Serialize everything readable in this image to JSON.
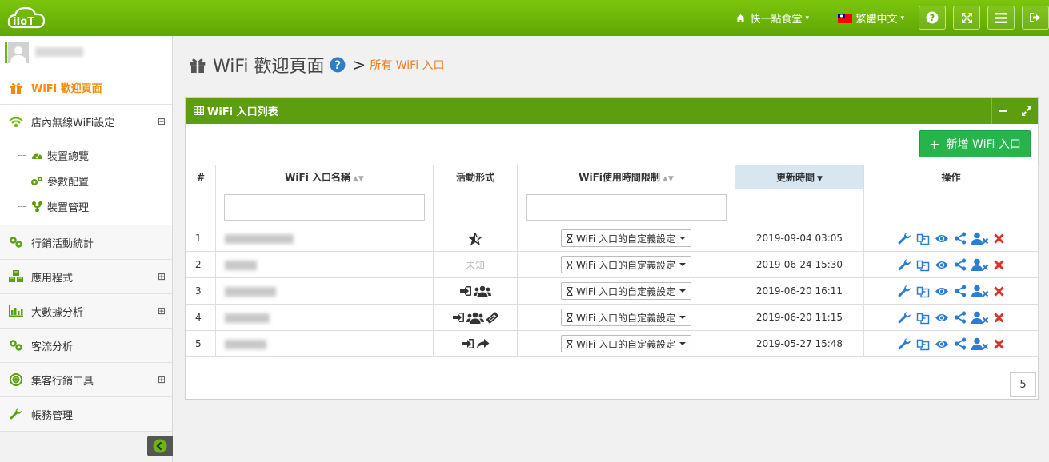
{
  "navbar": {
    "logo_text": "iIoT",
    "store": "快一點食堂",
    "language": "繁體中文",
    "flag_colors": {
      "red": "#fe0000",
      "blue": "#000095"
    }
  },
  "sidebar": {
    "items": [
      {
        "label": "WiFi 歡迎頁面",
        "icon": "gift-icon",
        "active": true
      },
      {
        "label": "店內無線WiFi設定",
        "icon": "wifi-icon",
        "expanded": true
      },
      {
        "label": "行銷活動統計",
        "icon": "link-icon"
      },
      {
        "label": "應用程式",
        "icon": "cubes-icon",
        "expandable": true
      },
      {
        "label": "大數據分析",
        "icon": "bar-chart-icon",
        "expandable": true
      },
      {
        "label": "客流分析",
        "icon": "link-icon"
      },
      {
        "label": "集客行銷工具",
        "icon": "target-icon",
        "expandable": true
      },
      {
        "label": "帳務管理",
        "icon": "wrench-icon"
      }
    ],
    "sub_items": [
      {
        "label": "裝置總覽",
        "icon": "dashboard-icon"
      },
      {
        "label": "參數配置",
        "icon": "cogs-icon"
      },
      {
        "label": "裝置管理",
        "icon": "sitemap-icon"
      }
    ],
    "expanded_symbol": "⊟",
    "collapsed_symbol": "⊞"
  },
  "page": {
    "title": "WiFi 歡迎頁面",
    "breadcrumb_sep": ">",
    "breadcrumb": "所有 WiFi 入口"
  },
  "panel": {
    "title": "WiFi 入口列表",
    "add_button": "新增 WiFi 入口"
  },
  "table": {
    "headers": [
      "#",
      "WiFi 入口名稱",
      "活動形式",
      "WiFi使用時間限制",
      "更新時間",
      "操作"
    ],
    "dropdown_label": "WiFi 入口的自定義設定",
    "rows": [
      {
        "num": "1",
        "activity": [
          "star-half-icon"
        ],
        "activity_text": "",
        "updated": "2019-09-04 03:05",
        "name_w": 86
      },
      {
        "num": "2",
        "activity": [],
        "activity_text": "未知",
        "updated": "2019-06-24 15:30",
        "name_w": 40
      },
      {
        "num": "3",
        "activity": [
          "sign-in-icon",
          "users-icon"
        ],
        "activity_text": "",
        "updated": "2019-06-20 16:11",
        "name_w": 64
      },
      {
        "num": "4",
        "activity": [
          "sign-in-icon",
          "users-icon",
          "ticket-icon"
        ],
        "activity_text": "",
        "updated": "2019-06-20 11:15",
        "name_w": 56
      },
      {
        "num": "5",
        "activity": [
          "sign-in-icon",
          "share-icon"
        ],
        "activity_text": "",
        "updated": "2019-05-27 15:48",
        "name_w": 52
      }
    ],
    "actions": [
      "edit-wrench-icon",
      "copy-icon",
      "view-eye-icon",
      "share-alt-icon",
      "user-times-icon",
      "delete-icon"
    ]
  },
  "pagination": {
    "page_size": "5"
  },
  "colors": {
    "navbar": "#6ab80c",
    "panel_header": "#5c9e0f",
    "active_text": "#ff8a00",
    "add_button": "#27b54b",
    "action_blue": "#2b7cd3",
    "delete_red": "#d9332b",
    "breadcrumb": "#f07b26"
  }
}
